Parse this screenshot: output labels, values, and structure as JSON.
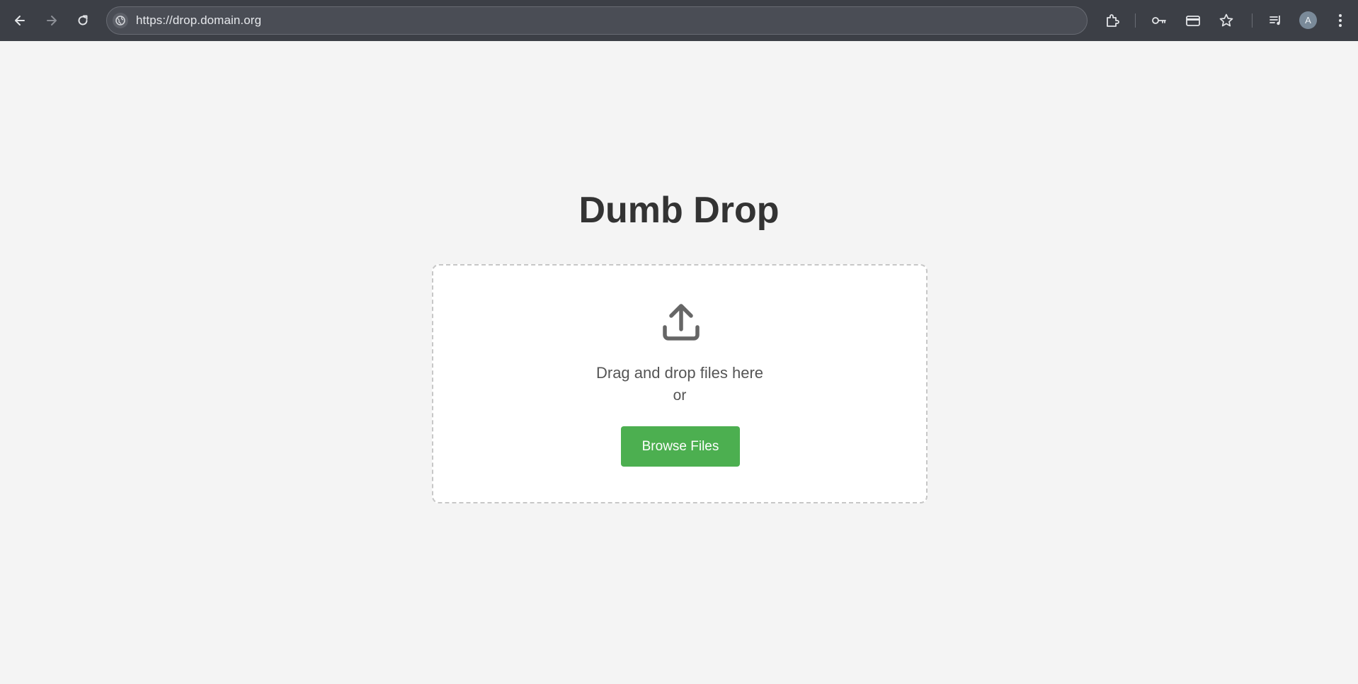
{
  "browser": {
    "url": "https://drop.domain.org",
    "profile_initial": "A",
    "icons": {
      "back": "back-arrow-icon",
      "forward": "forward-arrow-icon",
      "reload": "reload-icon",
      "site_info": "globe-icon",
      "extensions": "puzzle-icon",
      "passwords": "key-icon",
      "payments": "card-icon",
      "bookmark": "star-icon",
      "reading_list": "playlist-icon",
      "menu": "kebab-menu-icon"
    }
  },
  "page": {
    "title": "Dumb Drop",
    "drop_zone": {
      "icon": "upload-icon",
      "primary_text": "Drag and drop files here",
      "secondary_text": "or",
      "button_label": "Browse Files"
    }
  },
  "colors": {
    "accent": "#4caf50",
    "title": "#333333",
    "page_bg": "#f4f4f4",
    "toolbar_bg": "#3c3f46"
  }
}
